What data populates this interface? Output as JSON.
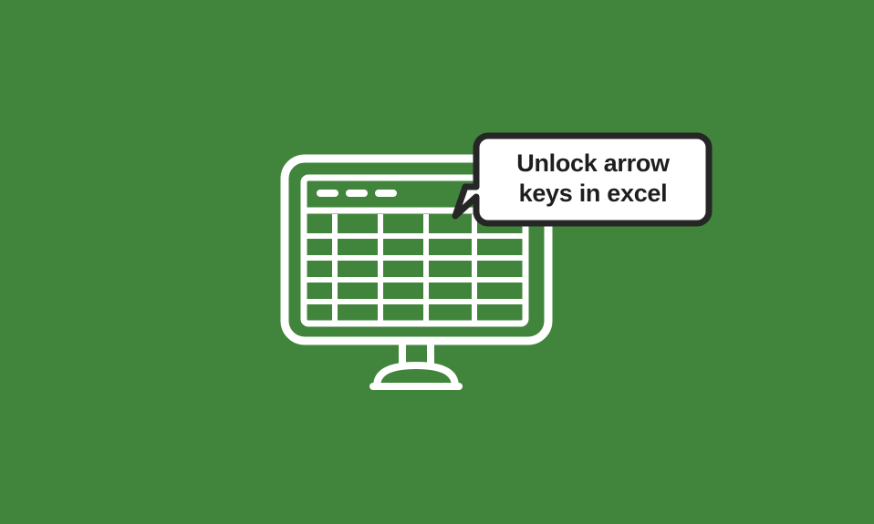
{
  "graphic": {
    "title": "Unlock arrow keys in excel",
    "background_color": "#41853C",
    "line_color": "#FFFFFF",
    "outline_color": "#262626",
    "bubble_fill": "#FFFFFF",
    "text_color": "#1E1E1E"
  },
  "speech_bubble": {
    "text": "Unlock arrow\nkeys in excel",
    "line_1": "Unlock arrow",
    "line_2": "keys in excel",
    "tail_direction": "bottom-left"
  },
  "monitor": {
    "icon_name": "desktop-monitor-icon",
    "screen": {
      "title_bar": {
        "dashes": 3
      },
      "spreadsheet": {
        "rows": 5,
        "columns": 5,
        "narrow_first_column": true
      }
    },
    "stand": {
      "neck": true,
      "base": "trapezoid"
    }
  }
}
